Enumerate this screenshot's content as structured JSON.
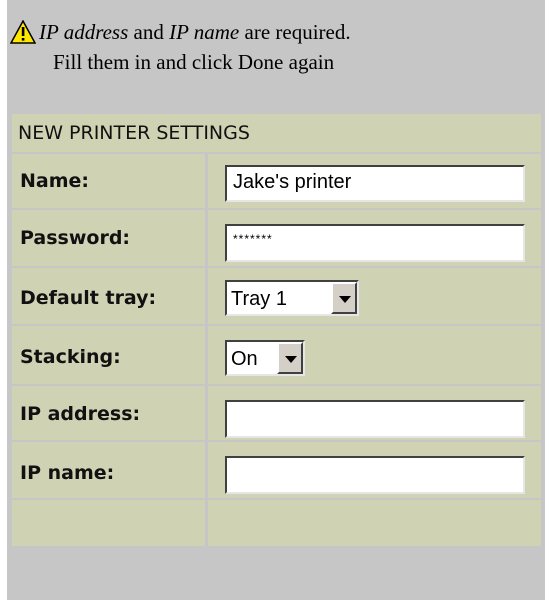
{
  "warning": {
    "icon": "warning-triangle-icon",
    "field1": "IP address",
    "and_text": " and ",
    "field2": "IP name",
    "required_text": " are required.",
    "line2": "Fill them in and click Done again"
  },
  "form": {
    "header": "NEW PRINTER SETTINGS",
    "rows": [
      {
        "label": "Name:",
        "value": "Jake's printer"
      },
      {
        "label": "Password:",
        "value": "*******"
      },
      {
        "label": "Default tray:",
        "value": "Tray 1"
      },
      {
        "label": "Stacking:",
        "value": "On"
      },
      {
        "label": "IP address:",
        "value": ""
      },
      {
        "label": "IP name:",
        "value": ""
      }
    ]
  }
}
